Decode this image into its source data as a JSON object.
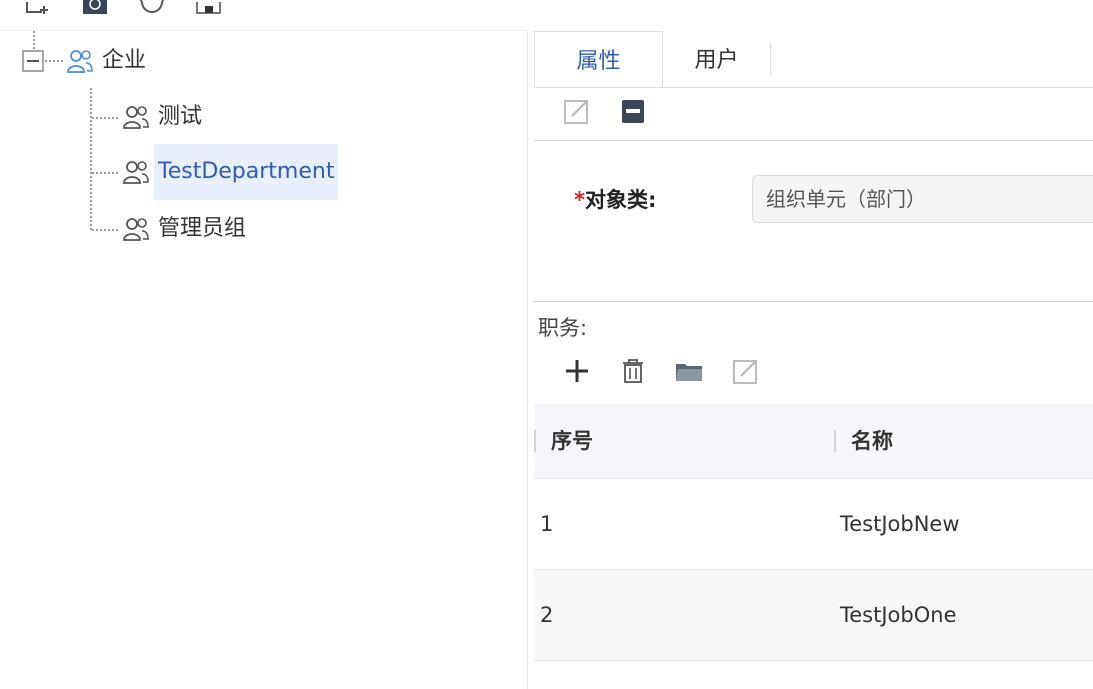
{
  "tree": {
    "root": {
      "label": "企业"
    },
    "children": [
      {
        "label": "测试"
      },
      {
        "label": "TestDepartment"
      },
      {
        "label": "管理员组"
      }
    ]
  },
  "tabs": [
    {
      "label": "属性"
    },
    {
      "label": "用户"
    }
  ],
  "form": {
    "required_mark": "*",
    "object_class_label": "对象类:",
    "object_class_value": "组织单元（部门）"
  },
  "jobs": {
    "section_title": "职务:",
    "columns": [
      "序号",
      "名称"
    ],
    "rows": [
      {
        "index": "1",
        "name": "TestJobNew"
      },
      {
        "index": "2",
        "name": "TestJobOne"
      }
    ]
  },
  "colors": {
    "accent": "#2f5db4",
    "selected_bg": "#e8eefb",
    "required": "#d61f1f"
  },
  "icons": [
    "add-org-icon",
    "badge-icon",
    "refresh-icon",
    "layout-icon",
    "person-group-icon",
    "collapse-icon",
    "edit-icon",
    "save-icon",
    "plus-icon",
    "trash-icon",
    "folder-icon"
  ]
}
